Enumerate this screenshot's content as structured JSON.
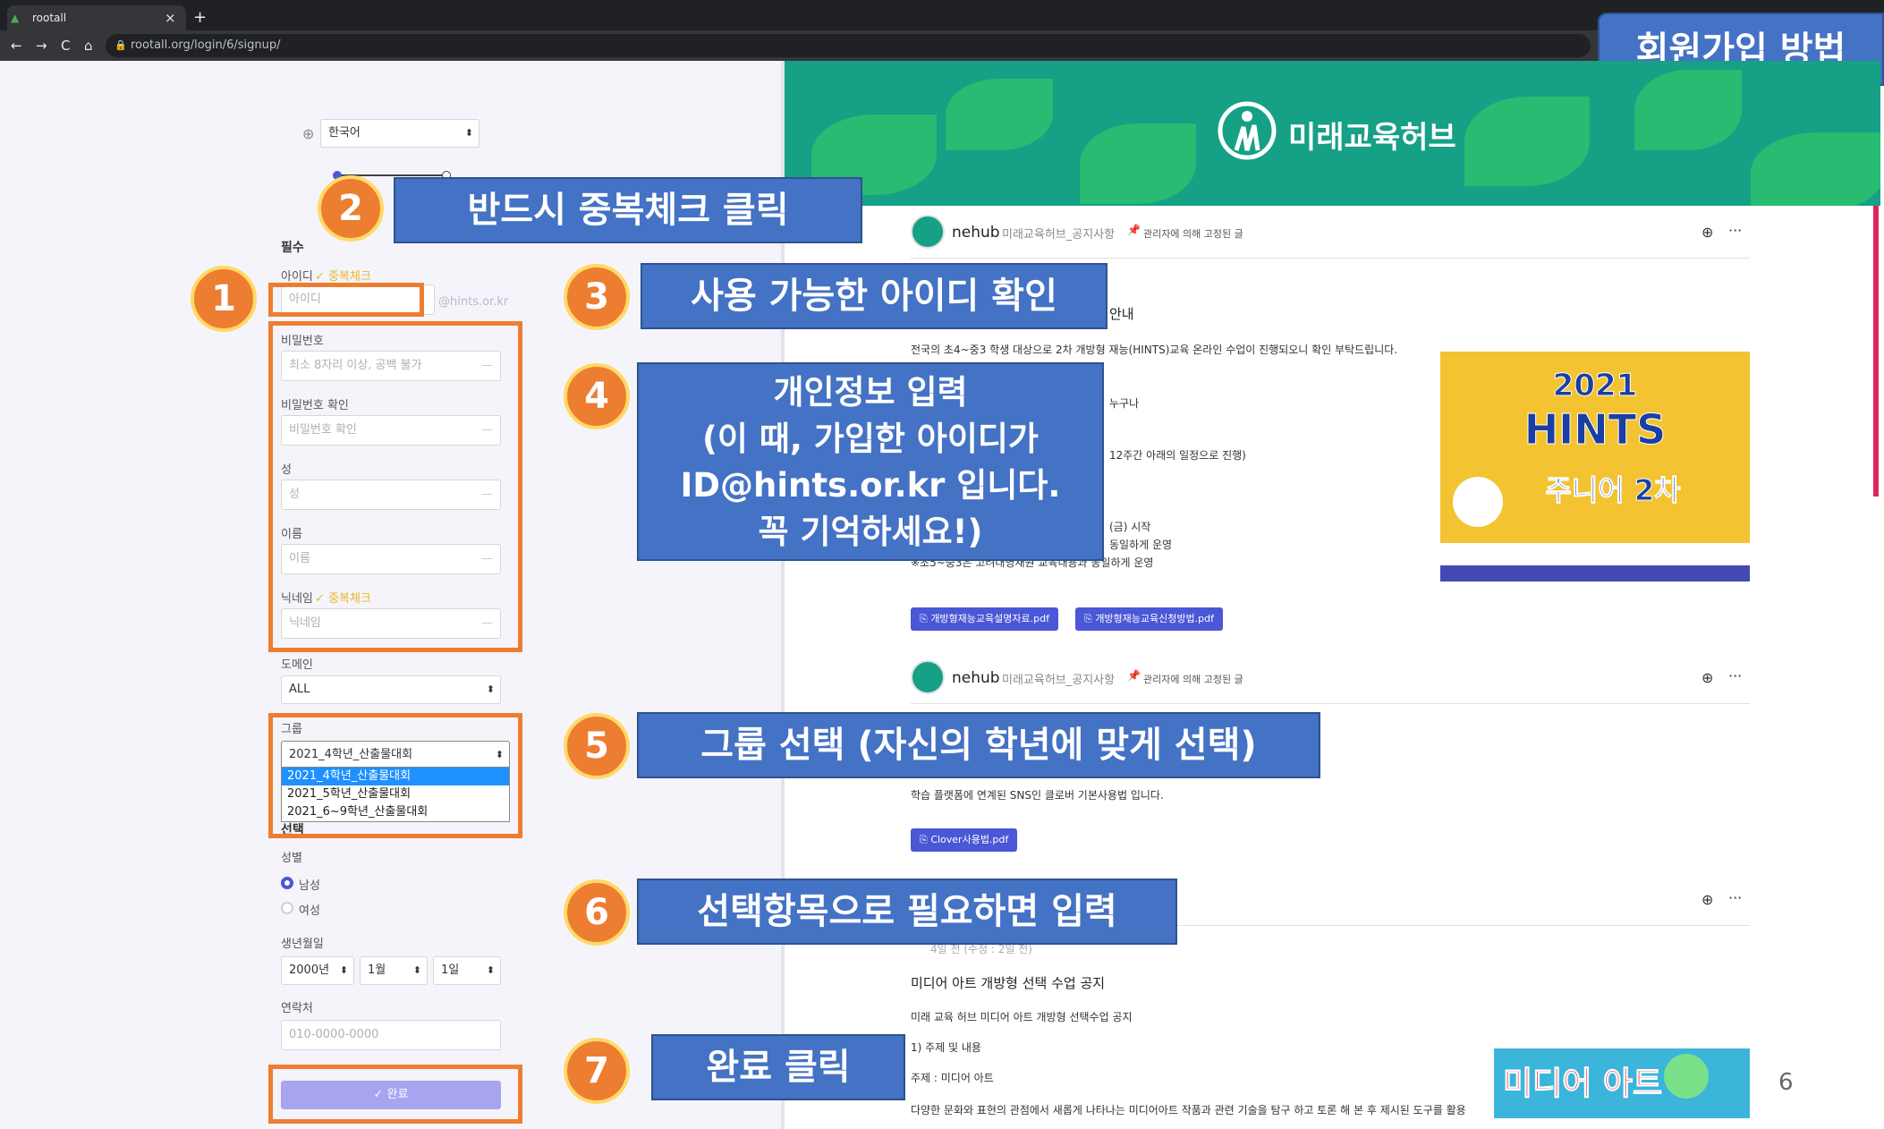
{
  "browser": {
    "tab_title": "rootall",
    "tab_close": "×",
    "new_tab": "+",
    "url": "rootall.org/login/6/signup/",
    "nav_back": "←",
    "nav_forward": "→",
    "nav_reload": "C",
    "nav_home": "⌂"
  },
  "slide_title": "회원가입 방법",
  "signup": {
    "language": "한국어",
    "required_label": "필수",
    "id_label": "아이디",
    "dup_check": "✓ 중복체크",
    "id_placeholder": "아이디",
    "domain_suffix": "@hints.or.kr",
    "password_label": "비밀번호",
    "password_placeholder": "최소 8자리 이상, 공백 불가",
    "password_confirm_label": "비밀번호 확인",
    "password_confirm_placeholder": "비밀번호 확인",
    "last_name_label": "성",
    "last_name_placeholder": "성",
    "first_name_label": "이름",
    "first_name_placeholder": "이름",
    "nickname_label": "닉네임",
    "nickname_placeholder": "닉네임",
    "domain_label": "도메인",
    "domain_value": "ALL",
    "group_label": "그룹",
    "group_value": "2021_4학년_산출물대회",
    "group_options": [
      "2021_4학년_산출물대회",
      "2021_5학년_산출물대회",
      "2021_6~9학년_산출물대회"
    ],
    "optional_label": "선택",
    "gender_label": "성별",
    "gender_male": "남성",
    "gender_female": "여성",
    "birth_label": "생년월일",
    "birth_year": "2000년",
    "birth_month": "1월",
    "birth_day": "1일",
    "contact_label": "연락처",
    "contact_placeholder": "010-0000-0000",
    "submit": "✓ 완료"
  },
  "annotations": [
    {
      "num": "1"
    },
    {
      "num": "2",
      "text": "반드시 중복체크 클릭"
    },
    {
      "num": "3",
      "text": "사용 가능한 아이디 확인"
    },
    {
      "num": "4",
      "lines": [
        "개인정보 입력",
        "(이 때, 가입한 아이디가",
        "ID@hints.or.kr 입니다.",
        "꼭 기억하세요!)"
      ]
    },
    {
      "num": "5",
      "text": "그룹 선택 (자신의 학년에 맞게 선택)"
    },
    {
      "num": "6",
      "text": "선택항목으로 필요하면 입력"
    },
    {
      "num": "7",
      "text": "완료 클릭"
    }
  ],
  "feed": {
    "brand": "미래교육허브",
    "posts": [
      {
        "author": "nehub",
        "board": "미래교육허브_공지사항",
        "pinned": "관리자에 의해 고정된 글",
        "title_fragment": "안내",
        "body": "전국의 초4~중3 학생 대상으로 2차 개방형 재능(HINTS)교육 온라인 수업이 진행되오니 확인 부탁드립니다.",
        "fragments": [
          "누구나",
          "12주간 아래의 일정으로 진행)",
          "(금) 시작",
          "동일하게 운영",
          "※초5~중3은 고려대영재원 교육내용과 동일하게 운영"
        ],
        "files": [
          "개방형재능교육설명자료.pdf",
          "개방형재능교육신청방법.pdf"
        ]
      },
      {
        "author": "nehub",
        "board": "미래교육허브_공지사항",
        "pinned": "관리자에 의해 고정된 글",
        "body": "학습 플랫폼에 연계된 SNS인 클로버 기본사용법 입니다.",
        "files": [
          "Clover사용법.pdf"
        ]
      },
      {
        "time": "4일 전 (수정 : 2일 전)",
        "title": "미디어 아트 개방형 선택 수업 공지",
        "lines": [
          "미래 교육 허브 미디어 아트 개방형 선택수업 공지",
          "1) 주제 및 내용",
          "주제 : 미디어 아트",
          "다양한 문화와 표현의 관점에서 새롭게 나타나는 미디어아트 작품과 관련 기술을 탐구 하고 토론 해 본 후 제시된 도구를 활용"
        ]
      }
    ],
    "hints_card": {
      "year": "2021",
      "name": "HINTS",
      "sub": "주니어 2차"
    },
    "media_card": "미디어 아트",
    "menu": "···",
    "globe": "⊕",
    "pin": "📌",
    "clip": "⎘"
  },
  "page_number": "6",
  "colors": {
    "callout": "#4472c4",
    "badge": "#ed7d31",
    "highlight_box": "#ed7d31",
    "accent": "#4a57d6",
    "banner": "#16a086"
  }
}
